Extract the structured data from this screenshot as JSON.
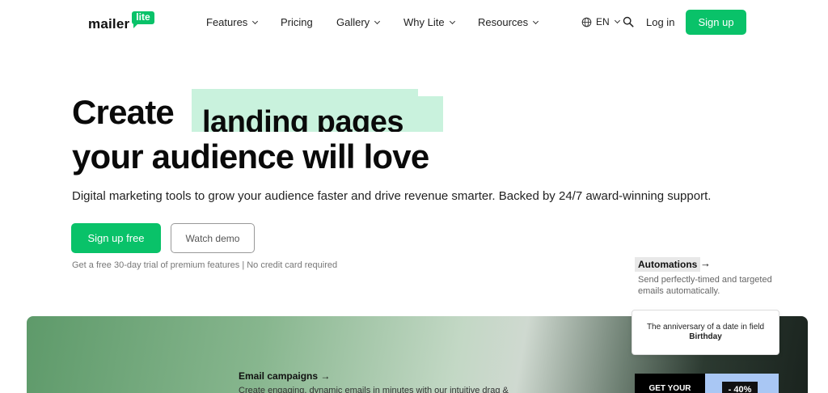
{
  "nav": {
    "logo_text": "mailer",
    "logo_badge": "lite",
    "items": [
      {
        "label": "Features",
        "dropdown": true
      },
      {
        "label": "Pricing",
        "dropdown": false
      },
      {
        "label": "Gallery",
        "dropdown": true
      },
      {
        "label": "Why Lite",
        "dropdown": true
      },
      {
        "label": "Resources",
        "dropdown": true
      }
    ],
    "language": "EN",
    "login": "Log in",
    "signup": "Sign up"
  },
  "hero": {
    "title_word": "Create",
    "title_highlight": "landing pages",
    "title_line2": "your audience will love",
    "subtitle": "Digital marketing tools to grow your audience faster and drive revenue smarter. Backed by 24/7 award-winning support.",
    "primary_button": "Sign up free",
    "secondary_button": "Watch demo",
    "trial_note": "Get a free 30-day trial of premium features | No credit card required"
  },
  "features": {
    "automations": {
      "title": "Automations",
      "arrow": "→",
      "description": "Send perfectly-timed and targeted emails automatically."
    },
    "email_campaigns": {
      "title": "Email campaigns",
      "arrow": "→",
      "description": "Create engaging, dynamic emails in minutes with our intuitive drag &"
    }
  },
  "automation_card": {
    "text": "The anniversary of a date in field",
    "field": "Birthday"
  },
  "promo": {
    "left_text": "GET YOUR",
    "badge": "- 40%"
  },
  "colors": {
    "brand_green": "#09c269",
    "highlight": "#c9f2dd"
  }
}
